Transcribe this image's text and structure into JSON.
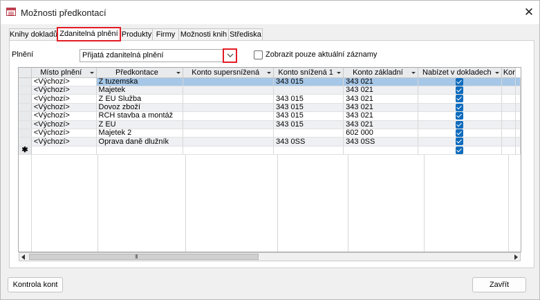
{
  "window": {
    "title": "Možnosti předkontací",
    "close_glyph": "✕"
  },
  "tabs": [
    {
      "label": "Knihy dokladů"
    },
    {
      "label": "Zdanitelná plnění",
      "active": true
    },
    {
      "label": "Produkty"
    },
    {
      "label": "Firmy"
    },
    {
      "label": "Možnosti knih"
    },
    {
      "label": "Střediska"
    }
  ],
  "filter": {
    "plneni_label": "Plnění",
    "plneni_value": "Přijatá zdanitelná plnění",
    "show_current_label": "Zobrazit pouze aktuální záznamy",
    "show_current_checked": false
  },
  "grid": {
    "columns": [
      "Místo plnění",
      "Předkontace",
      "Konto supersnížená",
      "Konto snížená 1",
      "Konto základní",
      "Nabízet v dokladech",
      "Kor"
    ],
    "rows": [
      {
        "misto": "<Výchozí>",
        "predkontace": "Z tuzemska",
        "supersnizena": "",
        "snizena1": "343 015",
        "zakladni": "343 021",
        "nabizet": true
      },
      {
        "misto": "<Výchozí>",
        "predkontace": "Majetek",
        "supersnizena": "",
        "snizena1": "",
        "zakladni": "343 021",
        "nabizet": true
      },
      {
        "misto": "<Výchozí>",
        "predkontace": "Z EU Služba",
        "supersnizena": "",
        "snizena1": "343 015",
        "zakladni": "343 021",
        "nabizet": true
      },
      {
        "misto": "<Výchozí>",
        "predkontace": "Dovoz zboží",
        "supersnizena": "",
        "snizena1": "343 015",
        "zakladni": "343 021",
        "nabizet": true
      },
      {
        "misto": "<Výchozí>",
        "predkontace": "RCH stavba a montáž",
        "supersnizena": "",
        "snizena1": "343 015",
        "zakladni": "343 021",
        "nabizet": true
      },
      {
        "misto": "<Výchozí>",
        "predkontace": "Z EU",
        "supersnizena": "",
        "snizena1": "343 015",
        "zakladni": "343 021",
        "nabizet": true
      },
      {
        "misto": "<Výchozí>",
        "predkontace": "Majetek 2",
        "supersnizena": "",
        "snizena1": "",
        "zakladni": "602 000",
        "nabizet": true
      },
      {
        "misto": "<Výchozí>",
        "predkontace": "Oprava daně dlužník",
        "supersnizena": "",
        "snizena1": "343 0SS",
        "zakladni": "343 0SS",
        "nabizet": true
      }
    ],
    "new_row_marker": "✱",
    "new_row_nabizet": true,
    "selected_row_index": 0
  },
  "scrollbar": {
    "grip": "III"
  },
  "buttons": {
    "kontrola": "Kontrola kont",
    "zavrit": "Zavřít"
  },
  "colors": {
    "accent_highlight": "#e31b23",
    "checkbox": "#0f6cbd",
    "selected_row": "#a6c7e7"
  }
}
